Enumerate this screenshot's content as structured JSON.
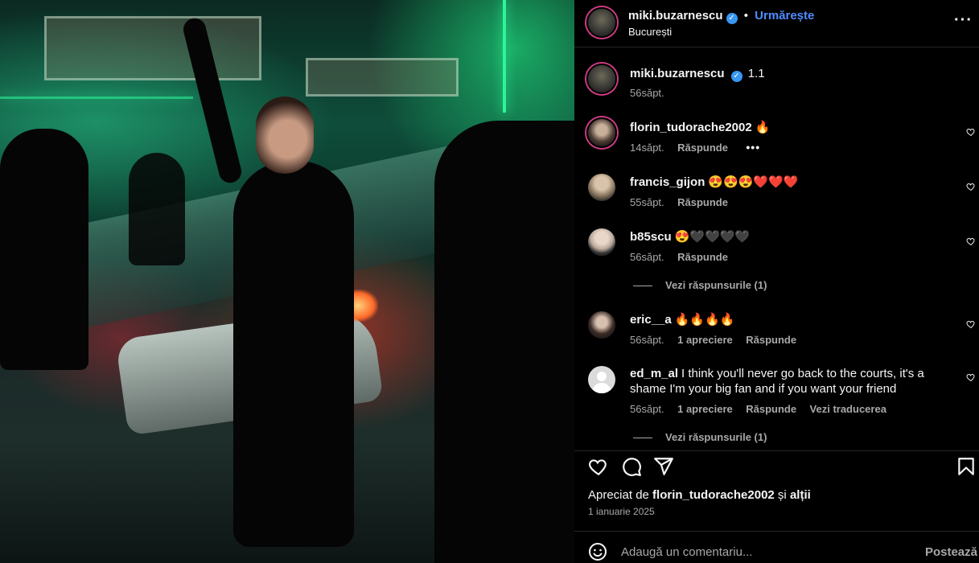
{
  "post": {
    "image_alt": "",
    "author": "miki.buzarnescu",
    "follow_label": "Urmărește",
    "location": "București",
    "more_icon": "more-horizontal-icon",
    "verified_icon": "verified-badge-icon"
  },
  "caption": {
    "username": "miki.buzarnescu",
    "text": "1.1",
    "time": "56săpt."
  },
  "comments": [
    {
      "username": "florin_tudorache2002",
      "text": "🔥",
      "time": "14săpt.",
      "likes": "",
      "reply": "Răspunde",
      "translate": "",
      "more": "•••"
    },
    {
      "username": "francis_gijon",
      "text": "😍😍😍❤️❤️❤️",
      "time": "55săpt.",
      "likes": "",
      "reply": "Răspunde",
      "translate": "",
      "more": ""
    },
    {
      "username": "b85scu",
      "text": "😍🖤🖤🖤🖤",
      "time": "56săpt.",
      "likes": "",
      "reply": "Răspunde",
      "translate": "",
      "more": ""
    },
    {
      "username": "eric__a",
      "text": "🔥🔥🔥🔥",
      "time": "56săpt.",
      "likes": "1 apreciere",
      "reply": "Răspunde",
      "translate": "",
      "more": ""
    },
    {
      "username": "ed_m_al",
      "text": "I think you'll never go back to the courts, it's a shame I'm your big fan and if you want your friend",
      "time": "56săpt.",
      "likes": "1 apreciere",
      "reply": "Răspunde",
      "translate": "Vezi traducerea",
      "more": ""
    }
  ],
  "view_replies": [
    "Vezi răspunsurile (1)",
    "Vezi răspunsurile (1)"
  ],
  "actions": {
    "like_icon": "heart-icon",
    "comment_icon": "comment-icon",
    "share_icon": "send-icon",
    "save_icon": "bookmark-icon"
  },
  "likes": {
    "prefix": "Apreciat de ",
    "user": "florin_tudorache2002",
    "middle": " și ",
    "others": "alții"
  },
  "date": "1 ianuarie 2025",
  "comment_input": {
    "placeholder": "Adaugă un comentariu...",
    "post_label": "Postează",
    "emoji_icon": "emoji-icon"
  },
  "colors": {
    "accent": "#4f8cff",
    "verified": "#3897f0",
    "background": "#000000",
    "muted": "#a8a8a8"
  }
}
